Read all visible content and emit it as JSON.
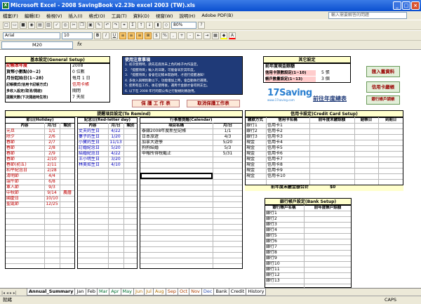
{
  "window": {
    "title": "Microsoft Excel - 2008 SavingBook v2.23b excel 2003 (TW).xls"
  },
  "menu": {
    "items": [
      "檔案(F)",
      "編輯(E)",
      "檢視(V)",
      "插入(I)",
      "格式(O)",
      "工具(T)",
      "資料(D)",
      "視窗(W)",
      "說明(H)",
      "Adobe PDF(B)"
    ],
    "help_placeholder": "輸入需要解答的問題"
  },
  "toolbar": {
    "font": "Arial",
    "size": "10",
    "zoom": "80%"
  },
  "formula": {
    "namebox": "M20",
    "fx": "fx"
  },
  "basic": {
    "header": "基本設定(General Setup)",
    "rows": [
      {
        "label": "記帳本年度",
        "value": "2008"
      },
      {
        "label": "貨幣小數點(0~2)",
        "value": "0 位數"
      },
      {
        "label": "月份起始日(1~28)",
        "value": "每月 1 日"
      },
      {
        "label": "記帳模式(信用卡記帳方式)",
        "value": "信用卡帳"
      },
      {
        "label": "多收入設定(取消/開啟)",
        "value": "關閉"
      },
      {
        "label": "提醒天數(下次開啟時生效)",
        "value": "7 天前"
      }
    ]
  },
  "notes": {
    "title": "使用注意事項",
    "lines": [
      "1. 初次使用時，請先在底頁未上色的格子內作設定。",
      "2. 「提醒項目」輸入的日期，可能會早於其年度。",
      "3. 「提醒項目」會會在記帳本開啟時，才進行提醒通知！",
      "4. 多收入與類別數以下，功能僅加上時，會自動執行選擇。",
      "5. 使用有些工作，後在使用後，選用卡金額才會得到支出。",
      "6. 以下在 2008 年行的開公佈之行動規則將啟用。"
    ],
    "btn_save": "保 護 工 作 表",
    "btn_unprotect": "取消保護工作表"
  },
  "other": {
    "header": "其它設定",
    "rows": [
      {
        "label": "前年度現金餘額",
        "value": ""
      },
      {
        "label": "信用卡張數設定(1~10)",
        "value": "5 張"
      },
      {
        "label": "帳戶數量設定(1~13)",
        "value": "3 個"
      }
    ]
  },
  "side_buttons": {
    "import": "匯入舊資料",
    "credit_pay": "信用卡繳帳",
    "bank_transfer": "銀行帳戶調帳"
  },
  "logo": {
    "brand": "17Saving",
    "sub": "www.17saving.com",
    "link": "前往年度總表"
  },
  "remind": {
    "header": "提醒項目設定(To Remind)",
    "holiday": {
      "title": "節日(Holiday)",
      "cols": [
        "內容",
        "月/日",
        "類別"
      ],
      "rows": [
        [
          "元旦",
          "1/1",
          ""
        ],
        [
          "除夕",
          "2/6",
          ""
        ],
        [
          "春節",
          "2/7",
          ""
        ],
        [
          "春節",
          "2/8",
          ""
        ],
        [
          "春節",
          "2/9",
          ""
        ],
        [
          "春節",
          "2/10",
          ""
        ],
        [
          "春節(初五)",
          "2/11",
          ""
        ],
        [
          "和平紀念日",
          "2/28",
          ""
        ],
        [
          "清明節",
          "4/4",
          ""
        ],
        [
          "端午節",
          "6/8",
          ""
        ],
        [
          "軍人節",
          "9/3",
          ""
        ],
        [
          "中秋節",
          "9/14",
          "農曆"
        ],
        [
          "國慶日",
          "10/10",
          ""
        ],
        [
          "聖誕節",
          "12/25",
          ""
        ]
      ]
    },
    "redletter": {
      "title": "紀念日(Red-letter day)",
      "cols": [
        "內容",
        "月/日",
        "類別"
      ],
      "rows": [
        [
          "丈夫的生日",
          "4/22",
          ""
        ],
        [
          "妻子的生日",
          "1/20",
          ""
        ],
        [
          "小寶的生日",
          "11/13",
          ""
        ],
        [
          "訂婚紀念日",
          "5/20",
          ""
        ],
        [
          "結婚紀念日",
          "4/22",
          ""
        ],
        [
          "王小明生日",
          "3/20",
          ""
        ],
        [
          "林美如生日",
          "4/10",
          ""
        ]
      ]
    },
    "calendar": {
      "title": "行事曆提醒(Calendar)",
      "cols": [
        "項目名稱",
        "月/日"
      ],
      "rows": [
        [
          "泰銀2008年度新型記帳",
          "1/1"
        ],
        [
          "日本旅遊",
          "4/3"
        ],
        [
          "加拿大遊學",
          "5/20"
        ],
        [
          "狗狗結婚",
          "5/3"
        ],
        [
          "申報所得稅截止",
          "5/31"
        ]
      ]
    }
  },
  "credit": {
    "header": "信用卡設定(Credit Card Setup)",
    "cols": [
      "繳款方式",
      "信用卡名稱",
      "前年度未繳餘額",
      "結帳日",
      "到期日"
    ],
    "rows": [
      [
        "銀行1",
        "信用卡1"
      ],
      [
        "銀行2",
        "信用卡2"
      ],
      [
        "銀行3",
        "信用卡3"
      ],
      [
        "現金",
        "信用卡4"
      ],
      [
        "現金",
        "信用卡5"
      ],
      [
        "現金",
        "信用卡6"
      ],
      [
        "現金",
        "信用卡7"
      ],
      [
        "現金",
        "信用卡8"
      ],
      [
        "現金",
        "信用卡9"
      ],
      [
        "現金",
        "信用卡10"
      ]
    ],
    "total_label": "前年度未繳金額合計",
    "total_value": "$0"
  },
  "bank": {
    "header": "銀行帳戶設定(Bank Setup)",
    "cols": [
      "銀行帳戶名稱",
      "前年度帳戶餘額"
    ],
    "rows": [
      "銀行1",
      "銀行2",
      "銀行3",
      "銀行4",
      "銀行5",
      "銀行6",
      "銀行7",
      "銀行8",
      "銀行9",
      "銀行10",
      "銀行11",
      "銀行12",
      "銀行13"
    ]
  },
  "tabs": [
    "Annual_Summary",
    "Jan",
    "Feb",
    "Mar",
    "Apr",
    "May",
    "Jun",
    "Jul",
    "Aug",
    "Sep",
    "Oct",
    "Nov",
    "Dec",
    "Bank",
    "Credit",
    "History"
  ],
  "status": {
    "ready": "就緒",
    "caps": "CAPS"
  }
}
